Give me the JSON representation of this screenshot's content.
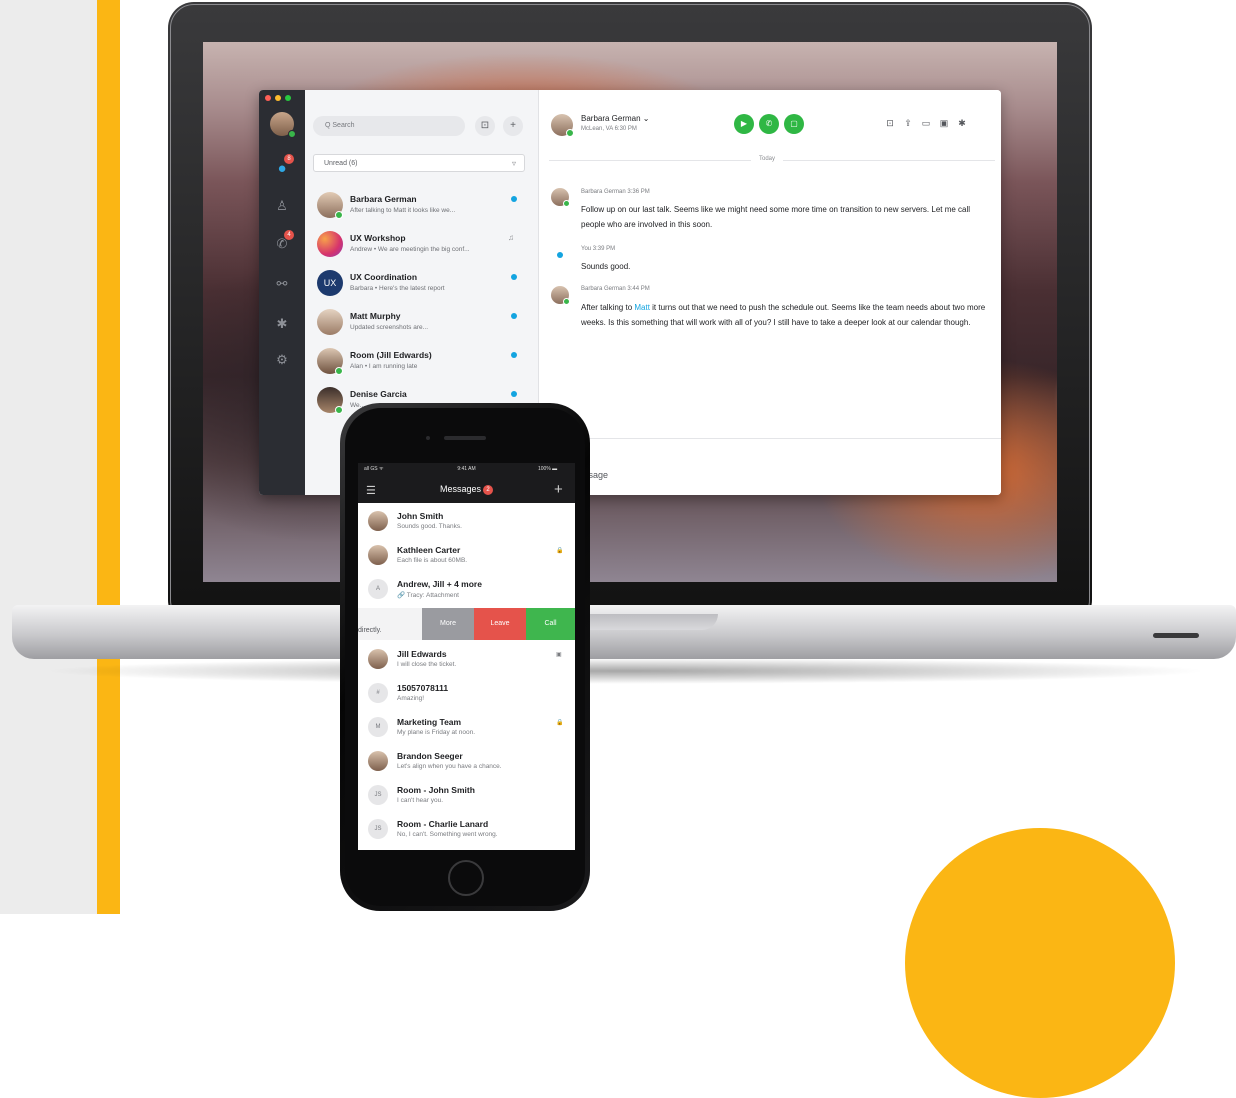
{
  "desktop": {
    "search": {
      "placeholder": "Q Search"
    },
    "add_button": "+",
    "filter": {
      "label": "Unread (6)"
    },
    "rail_badges": [
      "8",
      "4"
    ],
    "conversations": [
      {
        "name": "Barbara German",
        "preview": "After talking to Matt it looks like we...",
        "unread": true,
        "online": true
      },
      {
        "name": "UX Workshop",
        "preview": "Andrew • We are meetingin the big conf...",
        "unread": false,
        "online": false
      },
      {
        "name": "UX Coordination",
        "preview": "Barbara • Here's the latest report",
        "avatar_text": "UX",
        "unread": true,
        "online": false
      },
      {
        "name": "Matt Murphy",
        "preview": "Updated screenshots are...",
        "unread": true,
        "online": false
      },
      {
        "name": "Room (Jill Edwards)",
        "preview": "Alan • I am running late",
        "unread": true,
        "online": true
      },
      {
        "name": "Denise Garcia",
        "preview": "We...",
        "unread": true,
        "online": true
      }
    ],
    "header": {
      "name": "Barbara German ⌄",
      "location": "McLean, VA 6:30 PM"
    },
    "day_divider": "Today",
    "messages": [
      {
        "meta": "Barbara German  3:36 PM",
        "text": "Follow up on our last talk. Seems like we might need some more time on transition to new servers. Let me call people who are involved in this soon."
      },
      {
        "meta": "You  3:39 PM",
        "text": "Sounds good."
      },
      {
        "meta": "Barbara German  3:44 PM",
        "text_before": "After talking to ",
        "mention": "Matt",
        "text_after": " it turns out that we need to push the schedule out. Seems like the team needs about two more weeks. Is this something that will work with all of you? I still have to take a deeper look at our calendar though."
      }
    ],
    "compose_placeholder": "essage",
    "colors": {
      "accent_green": "#2fb744",
      "unread_blue": "#13a4e0",
      "badge_red": "#e5534b",
      "rail": "#2b2d33"
    }
  },
  "phone": {
    "status_left": "all GS ᯤ",
    "status_time": "9:41 AM",
    "status_right": "100% ▬",
    "title": "Messages",
    "badge": "2",
    "rows_top": [
      {
        "name": "John Smith",
        "preview": "Sounds good. Thanks.",
        "avatar": ""
      },
      {
        "name": "Kathleen Carter",
        "preview": "Each file is about 60MB.",
        "avatar": "",
        "flag": "🔒"
      },
      {
        "name": "Andrew, Jill + 4 more",
        "preview": "🔗 Tracy: Attachment",
        "avatar": "A"
      }
    ],
    "swipe": {
      "hint": "directly.",
      "more": "More",
      "leave": "Leave",
      "call": "Call"
    },
    "rows_bottom": [
      {
        "name": "Jill Edwards",
        "preview": "I will close the ticket.",
        "avatar": "",
        "flag": "▣"
      },
      {
        "name": "15057078111",
        "preview": "Amazing!",
        "avatar": "#"
      },
      {
        "name": "Marketing Team",
        "preview": "My plane is Friday at noon.",
        "avatar": "M",
        "flag": "🔒"
      },
      {
        "name": "Brandon Seeger",
        "preview": "Let's align when you have a chance.",
        "avatar": ""
      },
      {
        "name": "Room - John Smith",
        "preview": "I can't hear you.",
        "avatar": "JS"
      },
      {
        "name": "Room - Charlie Lanard",
        "preview": "No, I can't. Something went wrong.",
        "avatar": "JS"
      }
    ]
  },
  "colors": {
    "brand_yellow": "#fbb614",
    "side_gray": "#ececec"
  }
}
